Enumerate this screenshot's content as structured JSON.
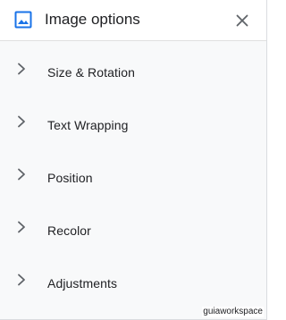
{
  "header": {
    "icon": "image-icon",
    "title": "Image options",
    "close_icon": "close-icon"
  },
  "sections": [
    {
      "label": "Size & Rotation",
      "icon": "chevron-right-icon"
    },
    {
      "label": "Text Wrapping",
      "icon": "chevron-right-icon"
    },
    {
      "label": "Position",
      "icon": "chevron-right-icon"
    },
    {
      "label": "Recolor",
      "icon": "chevron-right-icon"
    },
    {
      "label": "Adjustments",
      "icon": "chevron-right-icon"
    }
  ],
  "watermark": "guiaworkspace",
  "colors": {
    "accent": "#1a73e8",
    "text": "#202124",
    "icon_gray": "#5f6368",
    "panel_bg": "#f8f9fa"
  }
}
